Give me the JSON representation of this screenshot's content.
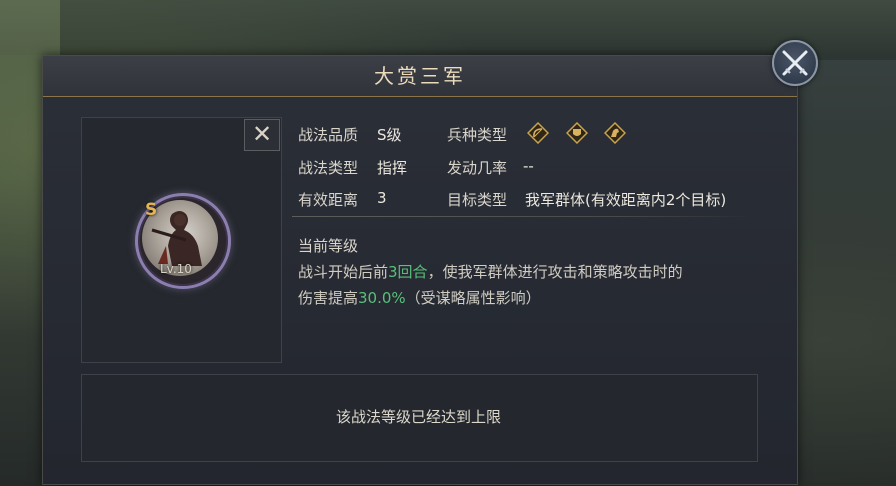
{
  "dialog": {
    "title": "大赏三军"
  },
  "tactic": {
    "grade": "S",
    "level": "Lv.10",
    "quality_label": "战法品质",
    "quality_value": "S级",
    "type_label": "战法类型",
    "type_value": "指挥",
    "range_label": "有效距离",
    "range_value": "3",
    "troop_label": "兵种类型",
    "troop_icons": [
      "bow-icon",
      "shield-icon",
      "horse-icon"
    ],
    "trigger_label": "发动几率",
    "trigger_value": "--",
    "target_label": "目标类型",
    "target_value": "我军群体(有效距离内2个目标)"
  },
  "effect": {
    "current_label": "当前等级",
    "desc_part1": "战斗开始后前",
    "desc_hl1": "3回合",
    "desc_part2": "，使我军群体进行攻击和策略攻击时的",
    "desc_part3": "伤害提高",
    "desc_hl2": "30.0%",
    "desc_part4": "（受谋略属性影响）"
  },
  "footer": {
    "max_level_text": "该战法等级已经达到上限"
  },
  "colors": {
    "highlight": "#58c07a",
    "title_gold": "#ecdcbc",
    "avatar_ring": "#8c7fb0"
  }
}
